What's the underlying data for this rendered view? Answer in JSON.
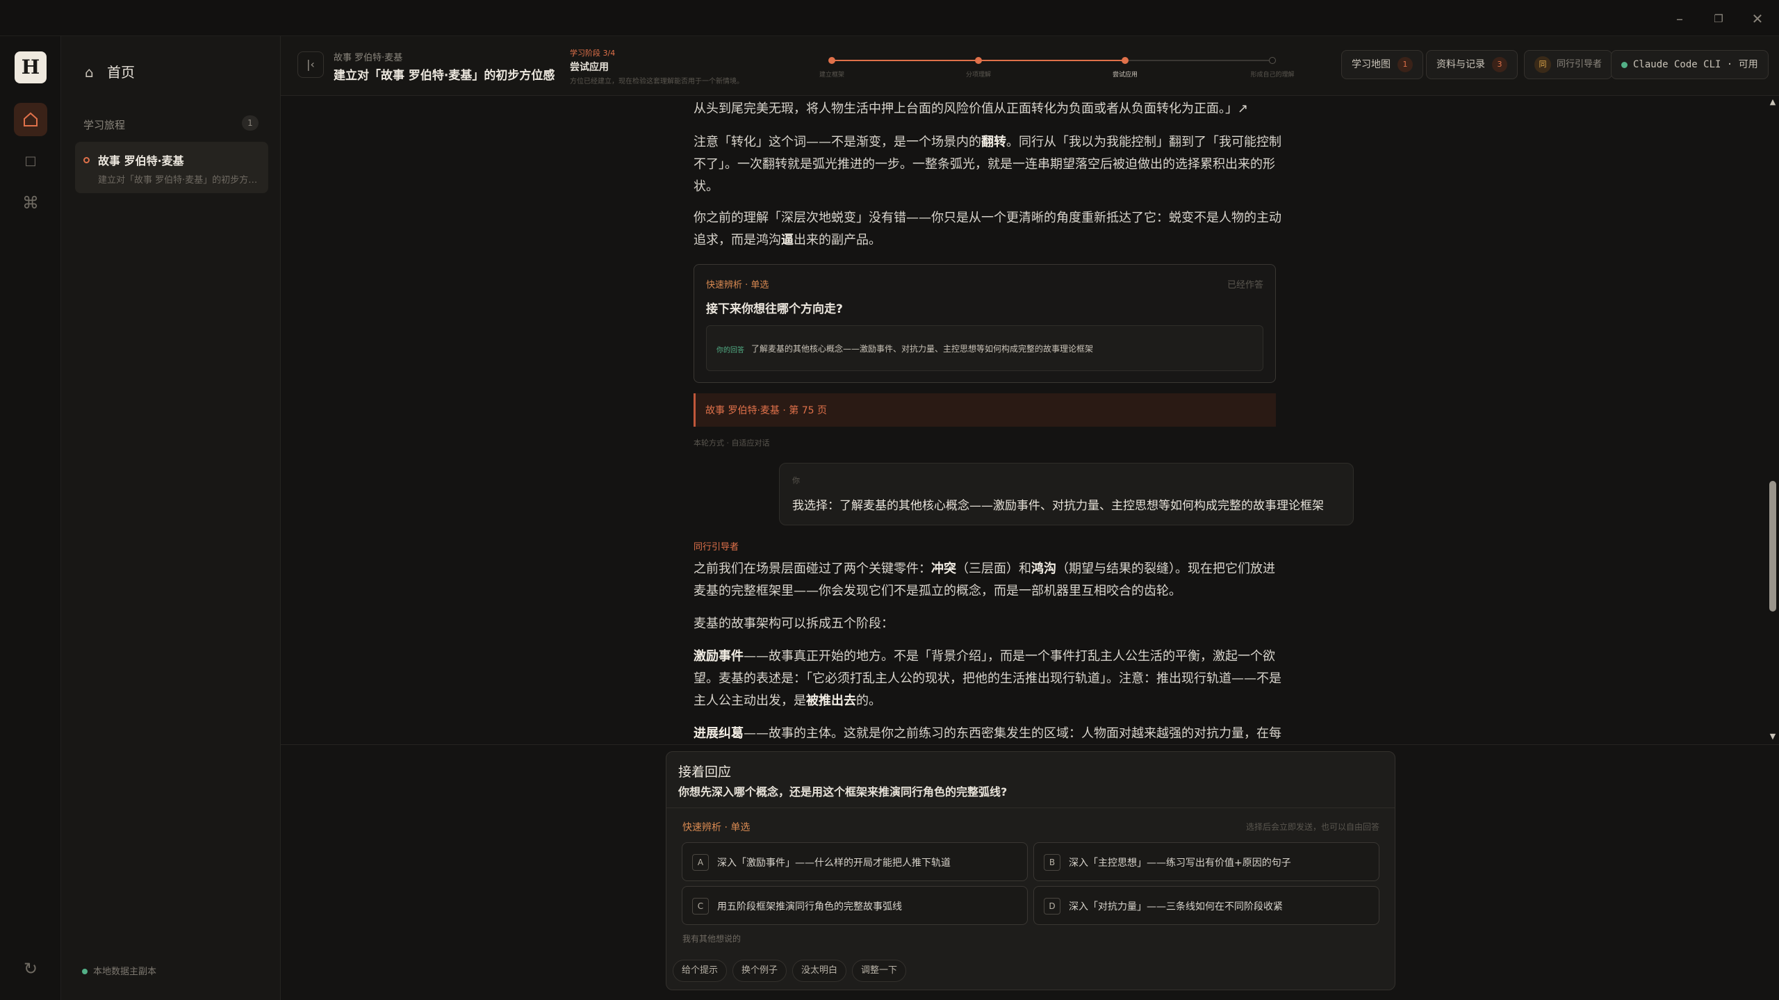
{
  "window": {
    "minimize_icon": "minimize-icon",
    "restore_icon": "restore-icon",
    "close_icon": "close-icon"
  },
  "rail": {
    "logo": "H",
    "items": [
      {
        "icon": "home-icon",
        "active": true
      },
      {
        "icon": "square-icon",
        "active": false
      },
      {
        "icon": "command-icon",
        "active": false
      },
      {
        "icon": "refresh-icon",
        "active": false
      }
    ]
  },
  "sidebar": {
    "home_label": "首页",
    "section_title": "学习旅程",
    "section_count": "1",
    "journey": {
      "title": "故事 罗伯特·麦基",
      "subtitle": "建立对「故事 罗伯特·麦基」的初步方位感"
    },
    "footer": "本地数据主副本"
  },
  "header": {
    "breadcrumb": "故事 罗伯特·麦基",
    "title": "建立对「故事 罗伯特·麦基」的初步方位感",
    "stage_label": "学习阶段 3/4",
    "stage_name": "尝试应用",
    "stage_sub": "方位已经建立，现在检验这套理解能否用于一个新情境。",
    "steps": [
      {
        "label": "建立框架",
        "done": true
      },
      {
        "label": "分项理解",
        "done": true
      },
      {
        "label": "尝试应用",
        "done": true,
        "current": true
      },
      {
        "label": "形成自己的理解",
        "done": false
      }
    ],
    "buttons": {
      "map": {
        "label": "学习地图",
        "badge": "1"
      },
      "records": {
        "label": "资料与记录",
        "badge": "3"
      },
      "peer": {
        "avatar": "同",
        "label": "同行引导者"
      },
      "status": {
        "label": "Claude Code CLI · 可用",
        "color": "#53b087"
      }
    }
  },
  "content": {
    "p1": "从头到尾完美无瑕，将人物生活中押上台面的风险价值从正面转化为负面或者从负面转化为正面。」↗",
    "p2_a": "注意「转化」这个词——不是渐变，是一个场景内的",
    "p2_b": "翻转",
    "p2_c": "。同行从「我以为我能控制」翻到了「我可能控制不了」。一次翻转就是弧光推进的一步。一整条弧光，就是一连串期望落空后被迫做出的选择累积出来的形状。",
    "p3_a": "你之前的理解「深层次地蜕变」没有错——你只是从一个更清晰的角度重新抵达了它：蜕变不是人物的主动追求，而是鸿沟",
    "p3_b": "逼",
    "p3_c": "出来的副产品。",
    "question_card": {
      "kind": "快速辨析 · 单选",
      "status": "已经作答",
      "question": "接下来你想往哪个方向走?",
      "answer_key": "你的回答",
      "answer": "了解麦基的其他核心概念——激励事件、对抗力量、主控思想等如何构成完整的故事理论框架"
    },
    "source": "故事 罗伯特·麦基 · 第 75 页",
    "mode": "本轮方式 · 自适应对话",
    "user": {
      "who": "你",
      "text": "我选择：了解麦基的其他核心概念——激励事件、对抗力量、主控思想等如何构成完整的故事理论框架"
    },
    "agent_label": "同行引导者",
    "a1_a": "之前我们在场景层面碰过了两个关键零件：",
    "a1_b": "冲突",
    "a1_c": "（三层面）和",
    "a1_d": "鸿沟",
    "a1_e": "（期望与结果的裂缝）。现在把它们放进麦基的完整框架里——你会发现它们不是孤立的概念，而是一部机器里互相咬合的齿轮。",
    "a2": "麦基的故事架构可以拆成五个阶段：",
    "a3_a": "激励事件",
    "a3_b": "——故事真正开始的地方。不是「背景介绍」，而是一个事件打乱主人公生活的平衡，激起一个欲望。麦基的表述是：「它必须打乱主人公的现状，把他的生活推出现行轨道」。注意：推出现行轨道——不是主人公主动出发，是",
    "a3_c": "被推出去",
    "a3_d": "的。",
    "a4_a": "进展纠葛",
    "a4_b": "——故事的主体。这就是你之前练习的东西密集发生的区域：人物面对越来越强的对抗力量，在每"
  },
  "composer": {
    "title": "接着回应",
    "question": "你想先深入哪个概念，还是用这个框架来推演同行角色的完整弧线?",
    "kind": "快速辨析 · 单选",
    "hint": "选择后会立即发送，也可以自由回答",
    "options": [
      {
        "key": "A",
        "text": "深入「激励事件」——什么样的开局才能把人推下轨道"
      },
      {
        "key": "B",
        "text": "深入「主控思想」——练习写出有价值+原因的句子"
      },
      {
        "key": "C",
        "text": "用五阶段框架推演同行角色的完整故事弧线"
      },
      {
        "key": "D",
        "text": "深入「对抗力量」——三条线如何在不同阶段收紧"
      }
    ],
    "other": "我有其他想说的",
    "chips": [
      "给个提示",
      "换个例子",
      "没太明白",
      "调整一下"
    ]
  },
  "colors": {
    "accent": "#e0714a",
    "background": "#141312",
    "ok": "#53b087"
  }
}
